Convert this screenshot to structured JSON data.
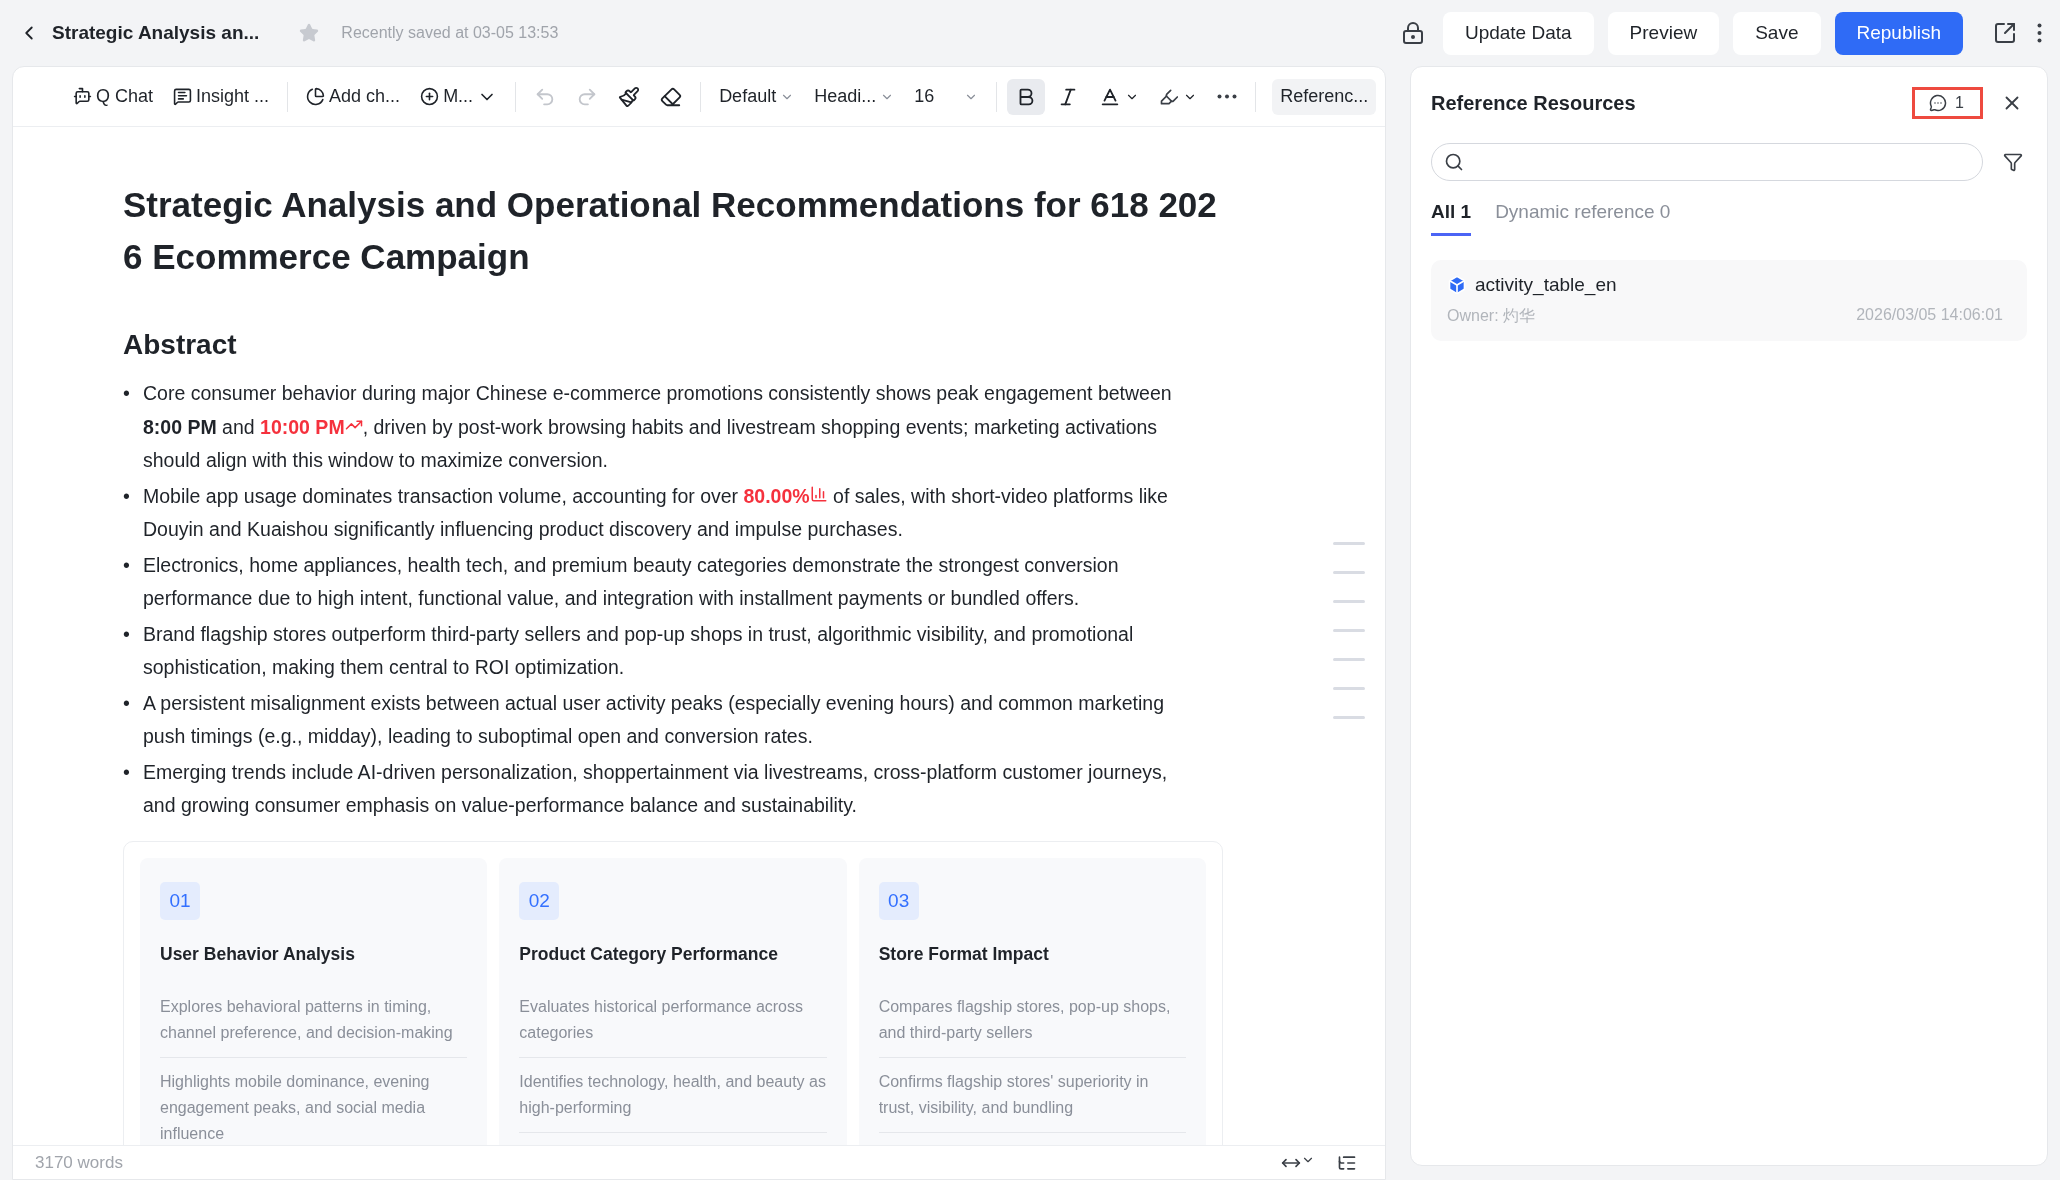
{
  "header": {
    "title": "Strategic Analysis an...",
    "starred": false,
    "save_status": "Recently saved at 03-05 13:53",
    "buttons": [
      {
        "label": "Update Data",
        "primary": false
      },
      {
        "label": "Preview",
        "primary": false
      },
      {
        "label": "Save",
        "primary": false
      },
      {
        "label": "Republish",
        "primary": true
      }
    ]
  },
  "toolbar": {
    "chat": "Q Chat",
    "insight": "Insight ...",
    "add_chart": "Add ch...",
    "more_menu": "M...",
    "undo": {
      "disabled": true
    },
    "redo": {
      "disabled": true
    },
    "font_family": "Default",
    "heading": "Headi...",
    "font_size": "16",
    "bold": {
      "selected": true
    },
    "italic": {
      "selected": false
    },
    "reference": "Referenc..."
  },
  "document": {
    "title": "Strategic Analysis and Operational Recommendations for 618 2026 Ecommerce Campaign",
    "section_heading": "Abstract",
    "bullets": [
      {
        "marker": "•",
        "segments": [
          {
            "kind": "plain",
            "text": "Core consumer behavior during major Chinese e-commerce promotions consistently shows peak engagement between "
          },
          {
            "kind": "bold",
            "text": "8:00 PM"
          },
          {
            "kind": "plain",
            "text": " and "
          },
          {
            "kind": "trend",
            "text": "10:00 PM"
          },
          {
            "kind": "plain",
            "text": ", driven by post-work browsing habits and livestream shopping events; marketing activations should align with this window to maximize conversion."
          }
        ]
      },
      {
        "marker": "•",
        "segments": [
          {
            "kind": "plain",
            "text": "Mobile app usage dominates transaction volume, accounting for over "
          },
          {
            "kind": "metric",
            "text": "80.00%"
          },
          {
            "kind": "plain",
            "text": " of sales, with short-video platforms like Douyin and Kuaishou significantly influencing product discovery and impulse purchases."
          }
        ]
      },
      {
        "marker": "•",
        "segments": [
          {
            "kind": "plain",
            "text": "Electronics, home appliances, health tech, and premium beauty categories demonstrate the strongest conversion performance due to high intent, functional value, and integration with installment payments or bundled offers."
          }
        ]
      },
      {
        "marker": "•",
        "segments": [
          {
            "kind": "plain",
            "text": "Brand flagship stores outperform third-party sellers and pop-up shops in trust, algorithmic visibility, and promotional sophistication, making them central to ROI optimization."
          }
        ]
      },
      {
        "marker": "•",
        "segments": [
          {
            "kind": "plain",
            "text": "A persistent misalignment exists between actual user activity peaks (especially evening hours) and common marketing push timings (e.g., midday), leading to suboptimal open and conversion rates."
          }
        ]
      },
      {
        "marker": "•",
        "segments": [
          {
            "kind": "plain",
            "text": "Emerging trends include AI-driven personalization, shoppertainment via livestreams, cross-platform customer journeys, and growing consumer emphasis on value-performance balance and sustainability."
          }
        ]
      }
    ],
    "cards": [
      {
        "number": "01",
        "title": "User Behavior Analysis",
        "points": [
          "Explores behavioral patterns in timing, channel preference, and decision-making",
          "Highlights mobile dominance, evening engagement peaks, and social media influence"
        ]
      },
      {
        "number": "02",
        "title": "Product Category Performance",
        "points": [
          "Evaluates historical performance across categories",
          "Identifies technology, health, and beauty as high-performing"
        ]
      },
      {
        "number": "03",
        "title": "Store Format Impact",
        "points": [
          "Compares flagship stores, pop-up shops, and third-party sellers",
          "Confirms flagship stores' superiority in trust, visibility, and bundling"
        ]
      }
    ],
    "word_count": "3170 words"
  },
  "reference_panel": {
    "title": "Reference Resources",
    "badge_count": "1",
    "tabs": [
      {
        "label": "All 1",
        "selected": true
      },
      {
        "label": "Dynamic reference 0",
        "selected": false
      }
    ],
    "items": [
      {
        "name": "activity_table_en",
        "owner": "Owner: 灼华",
        "date": "2026/03/05 14:06:01"
      }
    ]
  }
}
